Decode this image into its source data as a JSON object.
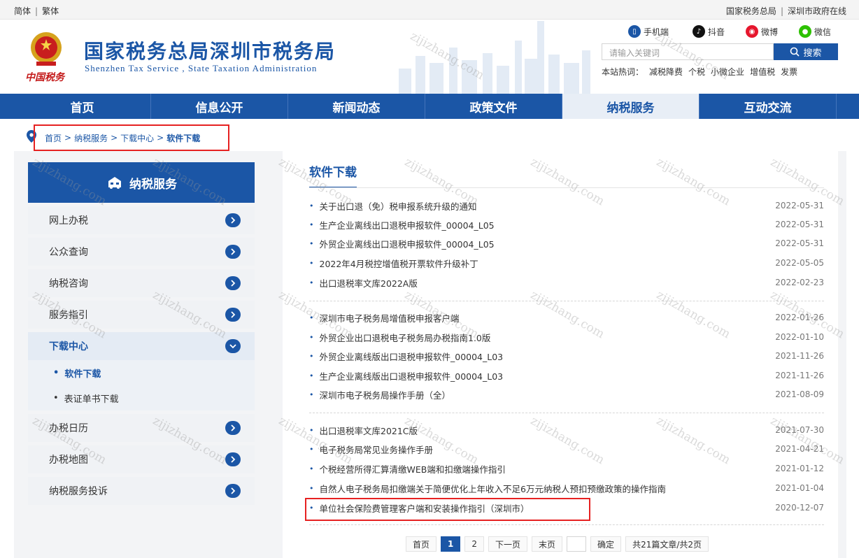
{
  "topbar": {
    "lang_simplified": "简体",
    "lang_traditional": "繁体",
    "link_state_admin": "国家税务总局",
    "link_sz_gov": "深圳市政府在线"
  },
  "header": {
    "site_name": "国家税务总局深圳市税务局",
    "site_name_en": "Shenzhen Tax Service , State Taxation Administration",
    "tax_mark": "中国税务",
    "social": [
      {
        "label": "手机端",
        "icon": "mobile-icon",
        "color": "#1b56a6"
      },
      {
        "label": "抖音",
        "icon": "douyin-icon",
        "color": "#111111"
      },
      {
        "label": "微博",
        "icon": "weibo-icon",
        "color": "#e6162d"
      },
      {
        "label": "微信",
        "icon": "wechat-icon",
        "color": "#2dc100"
      }
    ],
    "search_placeholder": "请输入关键词",
    "search_button": "搜索",
    "hot_label": "本站热词：",
    "hot_words": [
      "减税降费",
      "个税",
      "小微企业",
      "增值税",
      "发票"
    ]
  },
  "nav": {
    "items": [
      "首页",
      "信息公开",
      "新闻动态",
      "政策文件",
      "纳税服务",
      "互动交流"
    ],
    "active": "纳税服务"
  },
  "breadcrumb": {
    "items": [
      "首页",
      "纳税服务",
      "下载中心",
      "软件下载"
    ],
    "separator": ">"
  },
  "sidebar": {
    "title": "纳税服务",
    "items": [
      {
        "label": "网上办税"
      },
      {
        "label": "公众查询"
      },
      {
        "label": "纳税咨询"
      },
      {
        "label": "服务指引"
      },
      {
        "label": "下载中心"
      },
      {
        "label": "办税日历"
      },
      {
        "label": "办税地图"
      },
      {
        "label": "纳税服务投诉"
      }
    ],
    "sub_items": [
      "软件下载",
      "表证单书下载"
    ]
  },
  "main": {
    "title": "软件下载",
    "articles": [
      {
        "title": "关于出口退（免）税申报系统升级的通知",
        "date": "2022-05-31"
      },
      {
        "title": "生产企业离线出口退税申报软件_00004_L05",
        "date": "2022-05-31"
      },
      {
        "title": "外贸企业离线出口退税申报软件_00004_L05",
        "date": "2022-05-31"
      },
      {
        "title": "2022年4月税控增值税开票软件升级补丁",
        "date": "2022-05-05"
      },
      {
        "title": "出口退税率文库2022A版",
        "date": "2022-02-23"
      },
      {
        "title": "深圳市电子税务局增值税申报客户端",
        "date": "2022-01-26"
      },
      {
        "title": "外贸企业出口退税电子税务局办税指南1.0版",
        "date": "2022-01-10"
      },
      {
        "title": "外贸企业离线版出口退税申报软件_00004_L03",
        "date": "2021-11-26"
      },
      {
        "title": "生产企业离线版出口退税申报软件_00004_L03",
        "date": "2021-11-26"
      },
      {
        "title": "深圳市电子税务局操作手册（全）",
        "date": "2021-08-09"
      },
      {
        "title": "出口退税率文库2021C版",
        "date": "2021-07-30"
      },
      {
        "title": "电子税务局常见业务操作手册",
        "date": "2021-04-21"
      },
      {
        "title": "个税经营所得汇算清缴WEB端和扣缴端操作指引",
        "date": "2021-01-12"
      },
      {
        "title": "自然人电子税务局扣缴端关于简便优化上年收入不足6万元纳税人预扣预缴政策的操作指南",
        "date": "2021-01-04"
      },
      {
        "title": "单位社会保险费管理客户端和安装操作指引（深圳市）",
        "date": "2020-12-07"
      }
    ]
  },
  "pager": {
    "first": "首页",
    "pages": [
      "1",
      "2"
    ],
    "current": "1",
    "next": "下一页",
    "last": "末页",
    "confirm": "确定",
    "summary": "共21篇文章/共2页"
  },
  "watermark": "zijizhang.com",
  "colors": {
    "brand_blue": "#1b56a6",
    "highlight_red": "#e62121",
    "tax_mark_red": "#c41a1a"
  }
}
